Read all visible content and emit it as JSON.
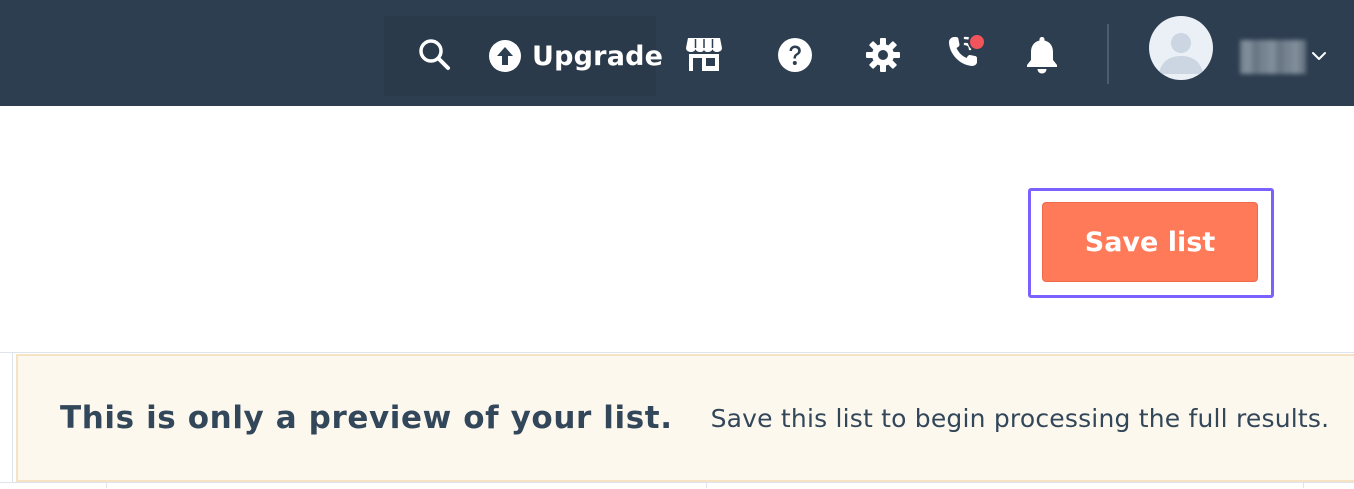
{
  "topbar": {
    "upgrade_label": "Upgrade",
    "icons": [
      "search-icon",
      "upgrade-arrow-icon",
      "marketplace-icon",
      "help-icon",
      "settings-icon",
      "calling-icon",
      "notifications-icon",
      "avatar",
      "chevron-down-icon"
    ],
    "calling_badge_color": "#f2545b",
    "background_color": "#2d3e50"
  },
  "actions": {
    "save_list_label": "Save list",
    "save_button_color": "#ff7a59",
    "focus_ring_color": "#7b61ff"
  },
  "banner": {
    "title": "This is only a preview of your list.",
    "text": "Save this list to begin processing the full results.",
    "background_color": "#fdf8ed"
  }
}
